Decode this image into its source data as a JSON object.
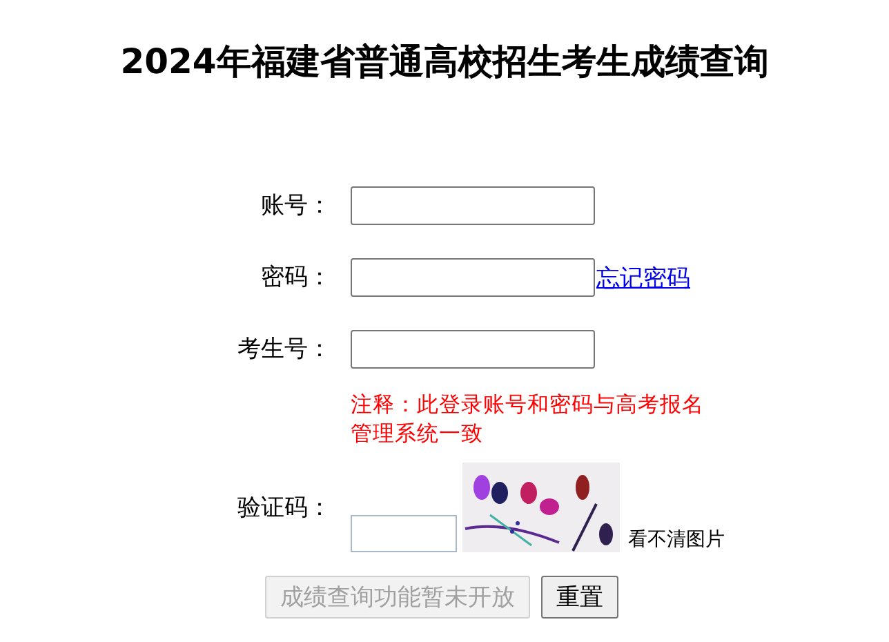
{
  "title": "2024年福建省普通高校招生考生成绩查询",
  "fields": [
    {
      "label": "账号："
    },
    {
      "label": "密码：",
      "link": "忘记密码"
    },
    {
      "label": "考生号："
    }
  ],
  "note": "注释：此登录账号和密码与高考报名管理系统一致",
  "captcha": {
    "label": "验证码：",
    "refresh_link": "看不清图片"
  },
  "buttons": [
    {
      "label": "成绩查询功能暂未开放",
      "disabled": true
    },
    {
      "label": "重置",
      "disabled": false
    }
  ]
}
